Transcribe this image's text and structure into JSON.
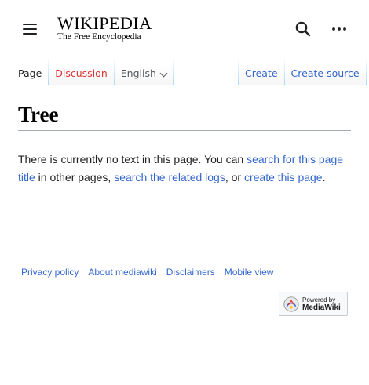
{
  "header": {
    "logo_wordmark": "WIKIPEDIA",
    "logo_tagline": "The Free Encyclopedia",
    "icons": {
      "menu": "hamburger-menu-icon",
      "search": "search-icon",
      "more": "ellipsis-icon"
    }
  },
  "tabs": {
    "left": [
      {
        "label": "Page",
        "state": "selected"
      },
      {
        "label": "Discussion",
        "state": "new"
      }
    ],
    "language": {
      "label": "English",
      "icon": "chevron-down-icon"
    },
    "right": [
      {
        "label": "Create"
      },
      {
        "label": "Create source"
      }
    ]
  },
  "page": {
    "title": "Tree",
    "body_text_1": "There is currently no text in this page. You can ",
    "link_search_title": "search for this page title",
    "body_text_2": " in other pages, ",
    "link_related_logs": "search the related logs",
    "body_text_3": ", or ",
    "link_create_page": "create this page",
    "body_text_4": "."
  },
  "footer": {
    "links": [
      "Privacy policy",
      "About mediawiki",
      "Disclaimers",
      "Mobile view"
    ],
    "powered_by_line1": "Powered by",
    "powered_by_line2": "MediaWiki"
  },
  "colors": {
    "link": "#3366cc",
    "new_link": "#dd3333",
    "text": "#202122",
    "tab_border": "#a7d7f9",
    "rule": "#a2a9b1"
  }
}
